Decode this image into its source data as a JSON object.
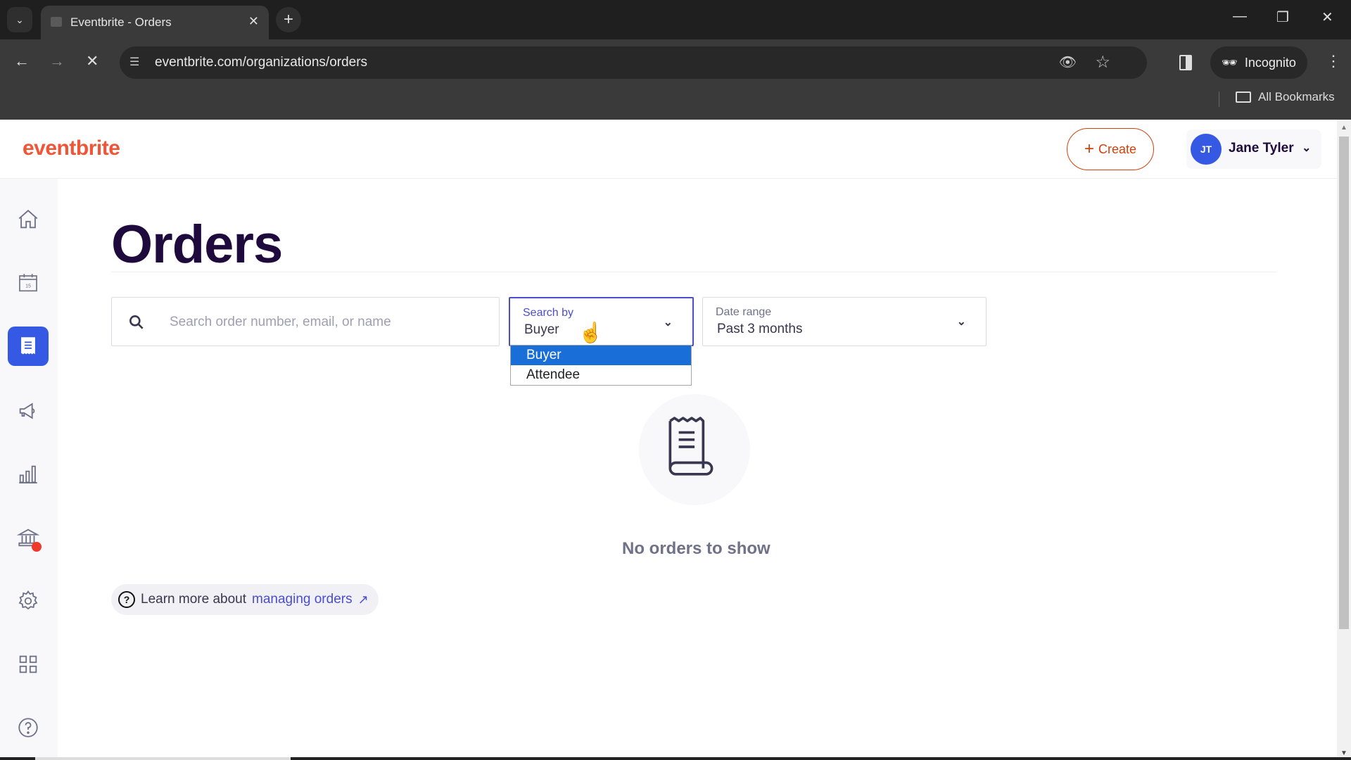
{
  "browser": {
    "tab_title": "Eventbrite - Orders",
    "url": "eventbrite.com/organizations/orders",
    "profile_label": "Incognito",
    "bookmarks_label": "All Bookmarks"
  },
  "header": {
    "logo": "eventbrite",
    "create_label": "Create",
    "user": {
      "initials": "JT",
      "name": "Jane Tyler"
    }
  },
  "sidebar": {
    "items": [
      {
        "name": "home",
        "icon": "home-icon",
        "active": false
      },
      {
        "name": "events",
        "icon": "calendar-icon",
        "active": false
      },
      {
        "name": "orders",
        "icon": "receipt-icon",
        "active": true
      },
      {
        "name": "marketing",
        "icon": "megaphone-icon",
        "active": false
      },
      {
        "name": "reporting",
        "icon": "bar-chart-icon",
        "active": false
      },
      {
        "name": "finance",
        "icon": "bank-icon",
        "active": false,
        "notification_dot": true
      },
      {
        "name": "settings",
        "icon": "gear-icon",
        "active": false
      },
      {
        "name": "apps",
        "icon": "grid-icon",
        "active": false
      },
      {
        "name": "help",
        "icon": "help-icon",
        "active": false
      }
    ],
    "calendar_day": "15"
  },
  "main": {
    "title": "Orders",
    "search": {
      "placeholder": "Search order number, email, or name",
      "value": ""
    },
    "search_by": {
      "label": "Search by",
      "value": "Buyer",
      "options": [
        "Buyer",
        "Attendee"
      ],
      "highlighted": "Buyer"
    },
    "date_range": {
      "label": "Date range",
      "value": "Past 3 months"
    },
    "empty_state": "No orders to show",
    "learn_more": {
      "prefix": "Learn more about",
      "link": "managing orders"
    }
  },
  "colors": {
    "brand": "#f05537",
    "accent": "#3659e3",
    "title": "#1e0a3c",
    "link": "#4b4dcf",
    "dropdown_highlight": "#1a6ed8"
  }
}
